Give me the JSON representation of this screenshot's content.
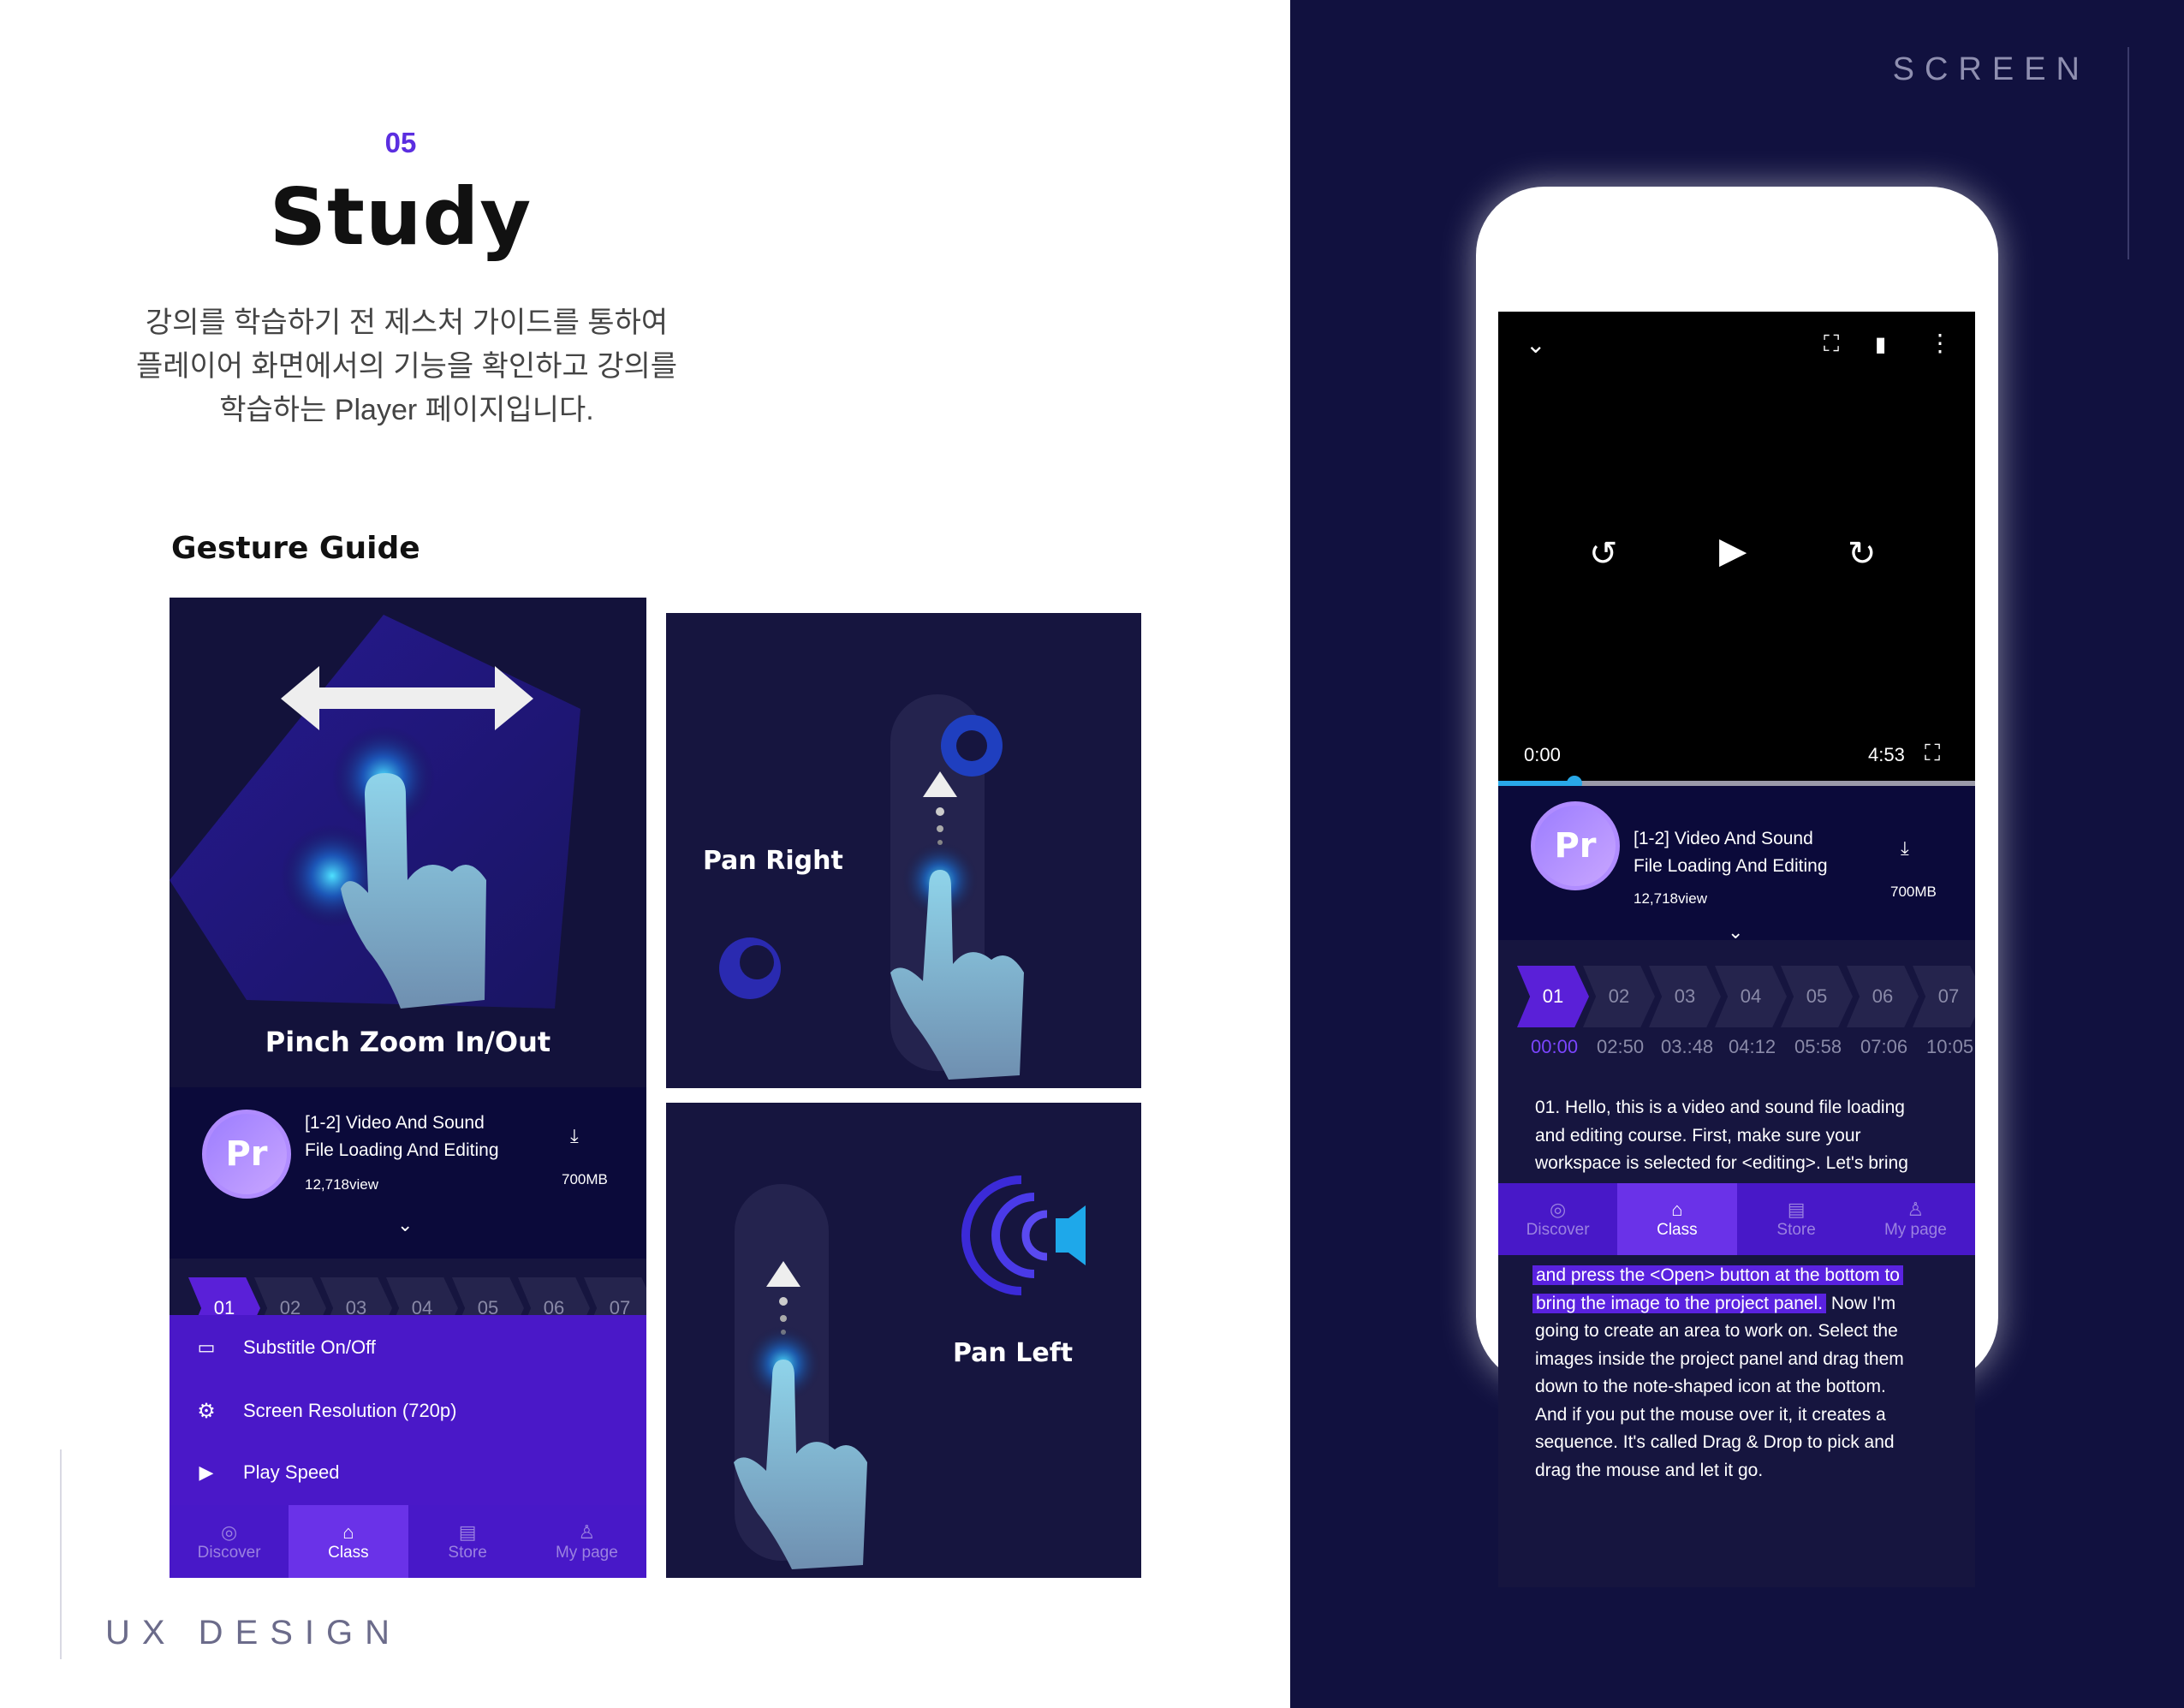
{
  "section": {
    "number": "05",
    "title": "Study",
    "desc_lines": [
      "강의를 학습하기 전 제스처 가이드를 통하여",
      "플레이어 화면에서의 기능을 확인하고 강의를",
      "학습하는 Player 페이지입니다."
    ]
  },
  "gesture_guide": {
    "title": "Gesture Guide",
    "pinch_label": "Pinch Zoom In/Out",
    "pan_right_label": "Pan Right",
    "pan_left_label": "Pan Left"
  },
  "lecture": {
    "title_line1": "[1-2] Video And Sound",
    "title_line2": "File Loading And Editing",
    "views": "12,718view",
    "size": "700MB",
    "app_badge": "Pr"
  },
  "player": {
    "current_time": "0:00",
    "duration": "4:53",
    "progress": 0.16
  },
  "chapters": [
    {
      "num": "01",
      "time": "00:00"
    },
    {
      "num": "02",
      "time": "02:50"
    },
    {
      "num": "03",
      "time": "03.:48"
    },
    {
      "num": "04",
      "time": "04:12"
    },
    {
      "num": "05",
      "time": "05:58"
    },
    {
      "num": "06",
      "time": "07:06"
    },
    {
      "num": "07",
      "time": "10:05"
    }
  ],
  "mini_chapters": [
    "01",
    "02",
    "03",
    "04",
    "05",
    "06",
    "07"
  ],
  "menu": {
    "subtitle": "Substitle On/Off",
    "resolution": "Screen Resolution (720p)",
    "speed": "Play Speed"
  },
  "nav": {
    "discover": "Discover",
    "class": "Class",
    "store": "Store",
    "mypage": "My page"
  },
  "subtitles": {
    "lines_top": [
      "01. Hello, this is a video and sound file loading",
      "and editing course. First, make sure your",
      "workspace is selected for <editing>. Let's bring"
    ],
    "hl_line1": "and press the <Open> button at the bottom to",
    "hl_line2": "bring the image to the project panel.",
    "line2_rest": " Now I'm",
    "lines_bottom": [
      "going to create an area to work on. Select the",
      "images inside the project panel and drag them",
      "down to the note-shaped icon at the bottom.",
      "And if you put the mouse over it, it creates a",
      "sequence.  It's called Drag & Drop to pick and",
      "drag the mouse and let it go."
    ]
  },
  "footer": {
    "left_label": "UX  DESIGN",
    "right_label": "SCREEN"
  },
  "colors": {
    "accent": "#5b2ee0",
    "dark_bg": "#11113f",
    "nav_bg": "#4818c8",
    "progress": "#29a8e8",
    "finger": "#7fc0d8"
  }
}
